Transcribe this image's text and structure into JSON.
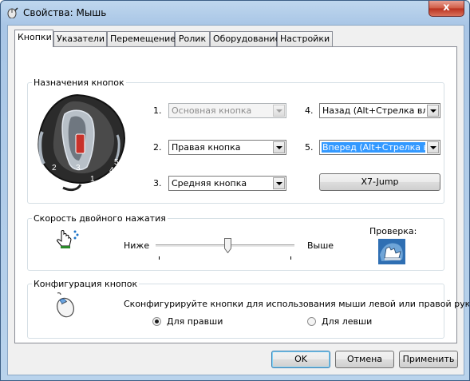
{
  "window": {
    "title": "Свойства: Мышь",
    "close_glyph": "x"
  },
  "tabs": [
    {
      "label": "Кнопки",
      "active": true
    },
    {
      "label": "Указатели"
    },
    {
      "label": "Перемещение"
    },
    {
      "label": "Ролик"
    },
    {
      "label": "Оборудование"
    },
    {
      "label": "Настройки"
    }
  ],
  "assignments": {
    "legend": "Назначения кнопок",
    "mouse_labels": [
      "1",
      "2",
      "3",
      "4",
      "5"
    ],
    "rows": [
      {
        "num": "1.",
        "value": "Основная кнопка",
        "disabled": true
      },
      {
        "num": "2.",
        "value": "Правая кнопка"
      },
      {
        "num": "3.",
        "value": "Средняя кнопка"
      },
      {
        "num": "4.",
        "value": "Назад (Alt+Стрелка влево)"
      },
      {
        "num": "5.",
        "value": "Вперед (Alt+Стрелка вправо)",
        "selected": true
      }
    ],
    "x7_button": "X7-Jump"
  },
  "double_click": {
    "legend": "Скорость двойного нажатия",
    "slow_label": "Ниже",
    "fast_label": "Выше",
    "test_label": "Проверка:",
    "speed_fraction": 0.52
  },
  "config": {
    "legend": "Конфигурация кнопок",
    "description": "Сконфигурируйте кнопки для использования мыши левой или правой рукой.",
    "right_label": "Для правши",
    "left_label": "Для левши",
    "selected": "right"
  },
  "footer": {
    "ok": "OK",
    "cancel": "Отмена",
    "apply": "Применить"
  },
  "icons": {
    "app": "mouse-app-icon",
    "pointer": "hand-pointer-icon",
    "test": "folder-test-icon",
    "config": "mouse-config-icon"
  }
}
